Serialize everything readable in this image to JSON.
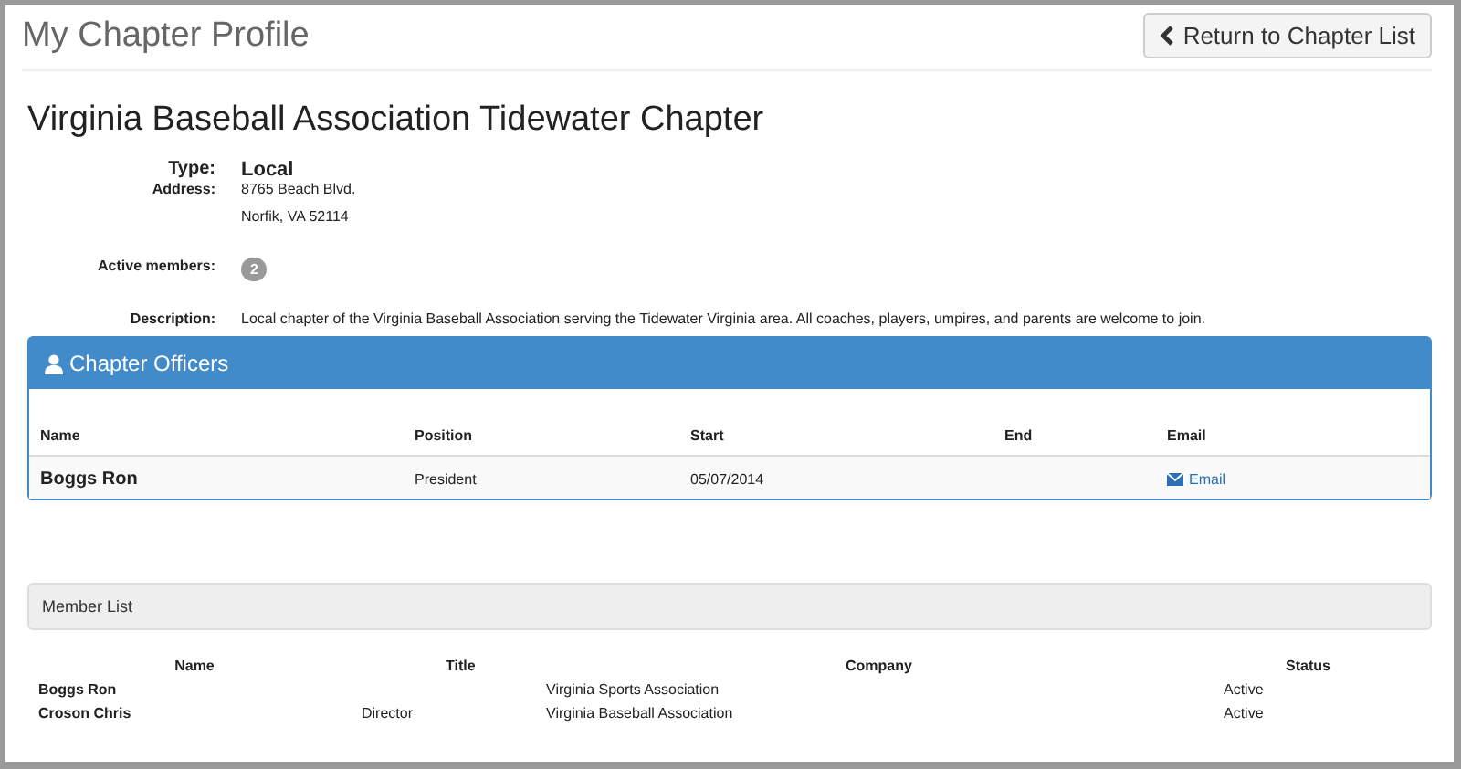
{
  "page_title": "My Chapter Profile",
  "return_button": "Return to Chapter List",
  "chapter": {
    "name": "Virginia Baseball Association Tidewater Chapter",
    "details": [
      {
        "label": "Type:",
        "lines": [
          "Local"
        ],
        "kind": "strong"
      },
      {
        "label": "Address:",
        "lines": [
          "8765 Beach Blvd.",
          "Norfik, VA 52114"
        ],
        "kind": "plain"
      },
      {
        "label": "Active members:",
        "lines": [
          "2"
        ],
        "kind": "badge"
      },
      {
        "label": "Description:",
        "lines": [
          "Local chapter of the Virginia Baseball Association serving the Tidewater Virginia area. All coaches, players, umpires, and parents are welcome to join."
        ],
        "kind": "plain"
      }
    ]
  },
  "officers": {
    "title": "Chapter Officers",
    "columns": [
      "Name",
      "Position",
      "Start",
      "End",
      "Email"
    ],
    "rows": [
      {
        "name": "Boggs Ron",
        "position": "President",
        "start": "05/07/2014",
        "end": "",
        "email": "Email"
      }
    ]
  },
  "members": {
    "title": "Member List",
    "columns": [
      "Name",
      "Title",
      "Company",
      "Status"
    ],
    "rows": [
      {
        "name": "Boggs Ron",
        "title": "",
        "company": "Virginia Sports Association",
        "status": "Active"
      },
      {
        "name": "Croson Chris",
        "title": "Director",
        "company": "Virginia Baseball Association",
        "status": "Active"
      }
    ]
  }
}
